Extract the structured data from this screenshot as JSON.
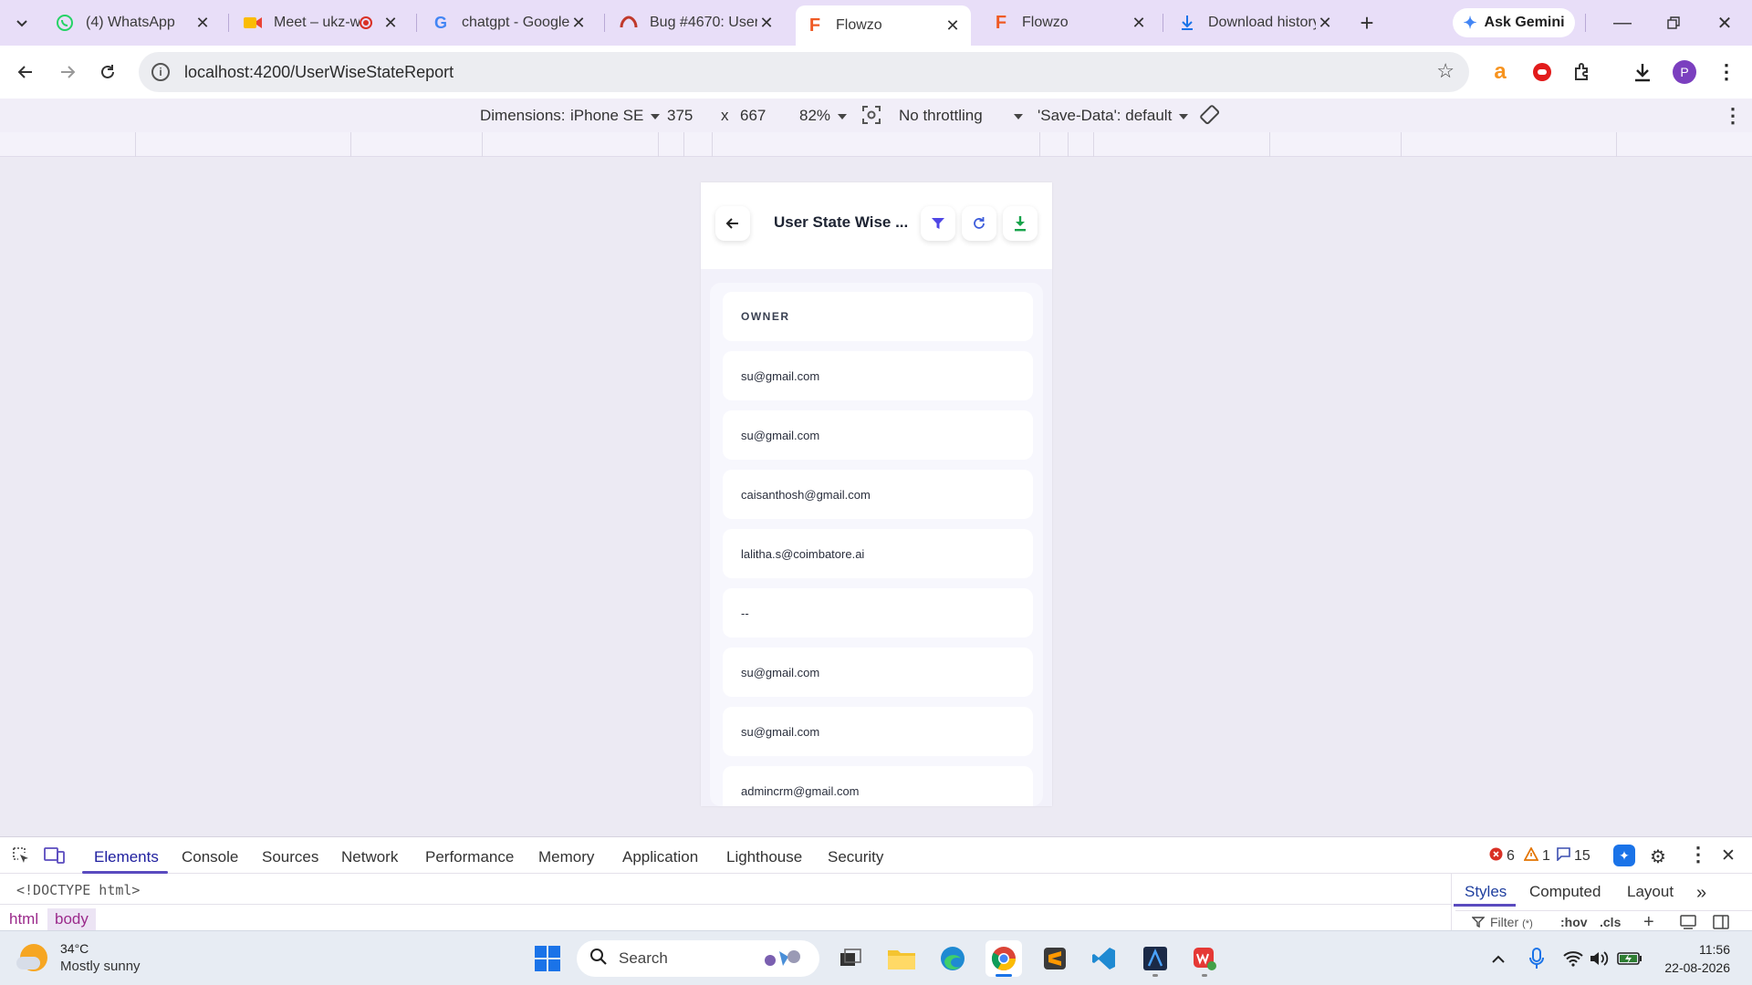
{
  "browser": {
    "tabs": [
      {
        "title": "(4) WhatsApp",
        "icon": "whatsapp-icon"
      },
      {
        "title": "Meet – ukz-w",
        "icon": "google-meet-icon",
        "recording": true
      },
      {
        "title": "chatgpt - Google",
        "icon": "google-icon"
      },
      {
        "title": "Bug #4670: User",
        "icon": "azure-devops-icon"
      },
      {
        "title": "Flowzo",
        "icon": "flowzo-icon",
        "active": true
      },
      {
        "title": "Flowzo",
        "icon": "flowzo-icon"
      },
      {
        "title": "Download history",
        "icon": "download-icon"
      }
    ],
    "ask_gemini": "Ask Gemini",
    "url": "localhost:4200/UserWiseStateReport",
    "profile_initial": "P"
  },
  "device_toolbar": {
    "dimensions_label": "Dimensions:",
    "device": "iPhone SE",
    "width": "375",
    "times": "x",
    "height": "667",
    "zoom": "82%",
    "throttling": "No throttling",
    "save_data": "'Save-Data': default"
  },
  "app": {
    "title": "User State Wise ...",
    "list_header": "OWNER",
    "rows": [
      "su@gmail.com",
      "su@gmail.com",
      "caisanthosh@gmail.com",
      "lalitha.s@coimbatore.ai",
      "--",
      "su@gmail.com",
      "su@gmail.com",
      "admincrm@gmail.com"
    ],
    "colors": {
      "accent": "#4f46e5",
      "refresh": "#3b5bdb",
      "download": "#16a34a"
    }
  },
  "devtools": {
    "tabs": [
      "Elements",
      "Console",
      "Sources",
      "Network",
      "Performance",
      "Memory",
      "Application",
      "Lighthouse",
      "Security"
    ],
    "errors": "6",
    "warnings": "1",
    "messages": "15",
    "doctype": "<!DOCTYPE html>",
    "breadcrumbs": [
      "html",
      "body"
    ],
    "styles_tabs": [
      "Styles",
      "Computed",
      "Layout"
    ],
    "filter_placeholder": "Filter",
    "filter_suffix": "(*)",
    "hov": ":hov",
    "cls": ".cls"
  },
  "taskbar": {
    "temperature": "34°C",
    "weather": "Mostly sunny",
    "search_placeholder": "Search",
    "time": "11:56",
    "date": "22-08-2026"
  }
}
